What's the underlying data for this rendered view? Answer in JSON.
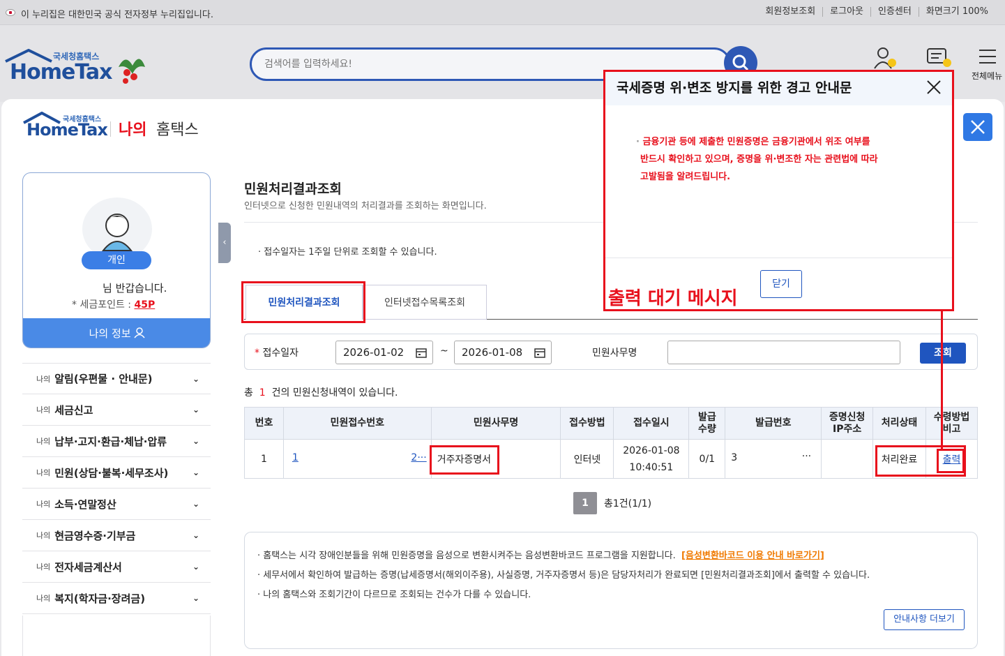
{
  "topbar": {
    "notice": "이 누리집은 대한민국 공식 전자정부 누리집입니다.",
    "links": [
      "회원정보조회",
      "로그아웃",
      "인증센터",
      "화면크기 100%"
    ]
  },
  "header": {
    "logo_small": "국세청홈택스",
    "logo_big": "HomeTax",
    "search_placeholder": "검색어를 입력하세요!",
    "right_label": "전체메뉴"
  },
  "mytax": {
    "logo_small": "국세청홈택스",
    "logo_big": "HomeTax",
    "title_red": "나의",
    "title_rest": "홈택스"
  },
  "profile": {
    "badge": "개인",
    "greeting": "님 반갑습니다.",
    "points_label": "세금포인트 :",
    "points_value": "45P",
    "myinfo": "나의 정보"
  },
  "menu": [
    {
      "pre": "나의",
      "label": "알림(우편물 · 안내문)"
    },
    {
      "pre": "나의",
      "label": "세금신고"
    },
    {
      "pre": "나의",
      "label": "납부·고지·환급·체납·압류"
    },
    {
      "pre": "나의",
      "label": "민원(상담·불복·세무조사)"
    },
    {
      "pre": "나의",
      "label": "소득·연말정산"
    },
    {
      "pre": "나의",
      "label": "현금영수증·기부금"
    },
    {
      "pre": "나의",
      "label": "전자세금계산서"
    },
    {
      "pre": "나의",
      "label": "복지(학자금·장려금)"
    }
  ],
  "page": {
    "title": "민원처리결과조회",
    "subtitle": "인터넷으로 신청한 민원내역의 처리결과를 조회하는 화면입니다.",
    "hint": "접수일자는 1주일 단위로 조회할 수 있습니다.",
    "tabs": [
      "민원처리결과조회",
      "인터넷접수목록조회"
    ]
  },
  "search": {
    "date_label": "접수일자",
    "date_from": "2026-01-02",
    "date_to": "2026-01-08",
    "tilde": "~",
    "name_label": "민원사무명",
    "button": "조회"
  },
  "summary": {
    "pre": "총",
    "count": "1",
    "post": "건의 민원신청내역이 있습니다."
  },
  "table": {
    "headers": [
      "번호",
      "민원접수번호",
      "민원사무명",
      "접수방법",
      "접수일시",
      "발급\n수량",
      "발급번호",
      "증명신청\nIP주소",
      "처리상태",
      "수령방법\n비고"
    ],
    "row": {
      "no": "1",
      "receipt_a": "1",
      "receipt_b": "2···",
      "name": "거주자증명서",
      "method": "인터넷",
      "date": "2026-01-08",
      "time": "10:40:51",
      "qty": "0/1",
      "issue_no": "3",
      "issue_more": "···",
      "ip": "",
      "status": "처리완료",
      "action": "출력"
    }
  },
  "pager": {
    "current": "1",
    "info": "총1건(1/1)"
  },
  "notes": {
    "items": [
      "홈택스는 시각 장애인분들을 위해 민원증명을 음성으로 변환시켜주는 음성변환바코드 프로그램을 지원합니다.",
      "세무서에서 확인하여 발급하는 증명(납세증명서(해외이주용), 사실증명, 거주자증명서 등)은 담당자처리가 완료되면 [민원처리결과조회]에서 출력할 수 있습니다.",
      "나의 홈택스와 조회기간이 다르므로 조회되는 건수가 다를 수 있습니다."
    ],
    "link": "[음성변환바코드 이용 안내 바로가기]",
    "more": "안내사항 더보기"
  },
  "modal": {
    "title": "국세증명 위·변조 방지를 위한 경고 안내문",
    "body_lines": [
      "금융기관 등에 제출한 민원증명은 금융기관에서 위조 여부를",
      "반드시 확인하고 있으며, 증명을 위·변조한 자는 관련법에 따라",
      "고발됨을 알려드립니다."
    ],
    "close": "닫기"
  },
  "annotation": "출력 대기 메시지",
  "colors": {
    "primary": "#1f55bf",
    "accent_red": "#e8101c",
    "link_orange": "#f07a00"
  }
}
